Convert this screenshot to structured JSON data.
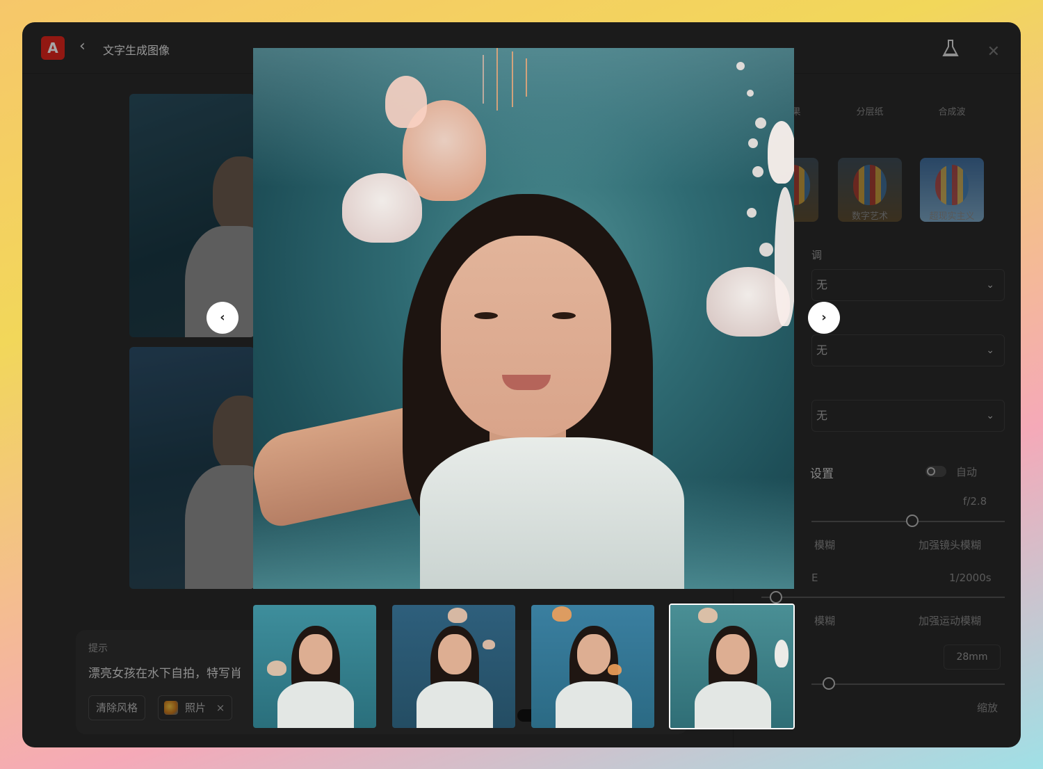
{
  "app": {
    "title": "文字生成图像",
    "logo_text": "A",
    "accent": "#e0261c"
  },
  "icons": {
    "back": "chevron-left-icon",
    "labs": "flask-icon",
    "close": "close-icon"
  },
  "prompt": {
    "label": "提示",
    "text": "漂亮女孩在水下自拍，特写肖",
    "clear_style": "清除风格",
    "style_chip": "照片",
    "style_chip_remove": "×"
  },
  "right_panel": {
    "styles_row1": [
      "果",
      "分层纸",
      "合成波"
    ],
    "styles_row2": [
      "数字艺术",
      "超现实主义"
    ],
    "section_tone": "调",
    "select1": "无",
    "select2": "无",
    "select3": "无",
    "settings_title": "设置",
    "auto_label": "自动",
    "aperture_value": "f/2.8",
    "blur_left": "模糊",
    "blur_right": "加强镜头模糊",
    "shutter_left": "E",
    "shutter_value": "1/2000s",
    "motion_left": "模糊",
    "motion_right": "加强运动模糊",
    "focal_value": "28mm",
    "zoom_label": "缩放"
  },
  "lightbox": {
    "prev": "‹",
    "next": "›",
    "selected_index": 3,
    "thumb_count": 4
  }
}
